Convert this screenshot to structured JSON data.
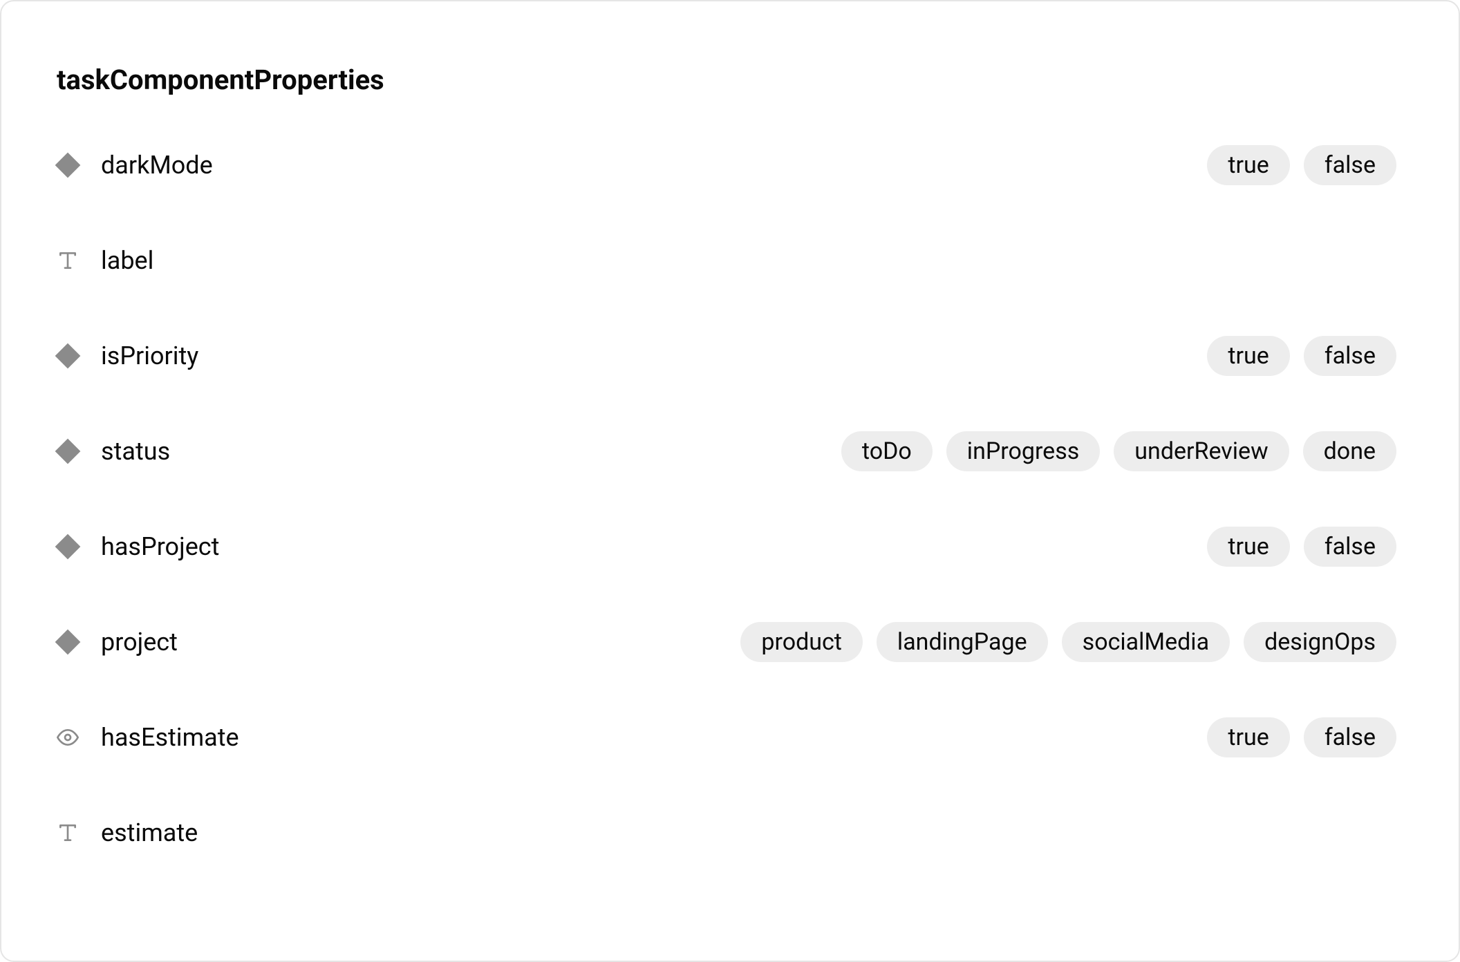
{
  "title": "taskComponentProperties",
  "properties": [
    {
      "icon": "variant",
      "name": "darkMode",
      "options": [
        "true",
        "false"
      ]
    },
    {
      "icon": "text",
      "name": "label",
      "options": []
    },
    {
      "icon": "variant",
      "name": "isPriority",
      "options": [
        "true",
        "false"
      ]
    },
    {
      "icon": "variant",
      "name": "status",
      "options": [
        "toDo",
        "inProgress",
        "underReview",
        "done"
      ]
    },
    {
      "icon": "variant",
      "name": "hasProject",
      "options": [
        "true",
        "false"
      ]
    },
    {
      "icon": "variant",
      "name": "project",
      "options": [
        "product",
        "landingPage",
        "socialMedia",
        "designOps"
      ]
    },
    {
      "icon": "boolean",
      "name": "hasEstimate",
      "options": [
        "true",
        "false"
      ]
    },
    {
      "icon": "text",
      "name": "estimate",
      "options": []
    }
  ]
}
